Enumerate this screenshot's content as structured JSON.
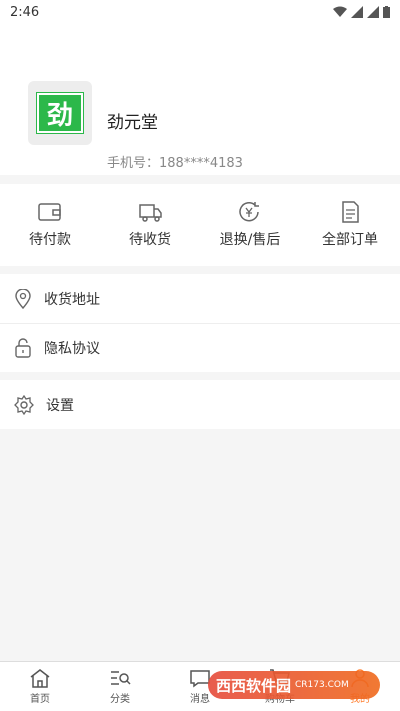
{
  "status_bar": {
    "time": "2:46"
  },
  "profile": {
    "logo_text": "劲",
    "name": "劲元堂",
    "phone": "手机号：188****4183"
  },
  "orders": [
    {
      "label": "待付款",
      "icon": "wallet-icon"
    },
    {
      "label": "待收货",
      "icon": "truck-icon"
    },
    {
      "label": "退换/售后",
      "icon": "refund-icon"
    },
    {
      "label": "全部订单",
      "icon": "order-list-icon"
    }
  ],
  "menu": {
    "address": "收货地址",
    "privacy": "隐私协议",
    "settings": "设置"
  },
  "tabbar": [
    {
      "label": "首页",
      "icon": "home-icon"
    },
    {
      "label": "分类",
      "icon": "category-icon"
    },
    {
      "label": "消息",
      "icon": "message-icon"
    },
    {
      "label": "购物车",
      "icon": "cart-icon"
    },
    {
      "label": "我的",
      "icon": "profile-icon"
    }
  ],
  "watermark": {
    "text": "西西软件园",
    "sub": "CR173.COM"
  },
  "colors": {
    "accent": "#ff7e2e",
    "logo_green": "#2cb84a",
    "background": "#f5f5f5"
  }
}
